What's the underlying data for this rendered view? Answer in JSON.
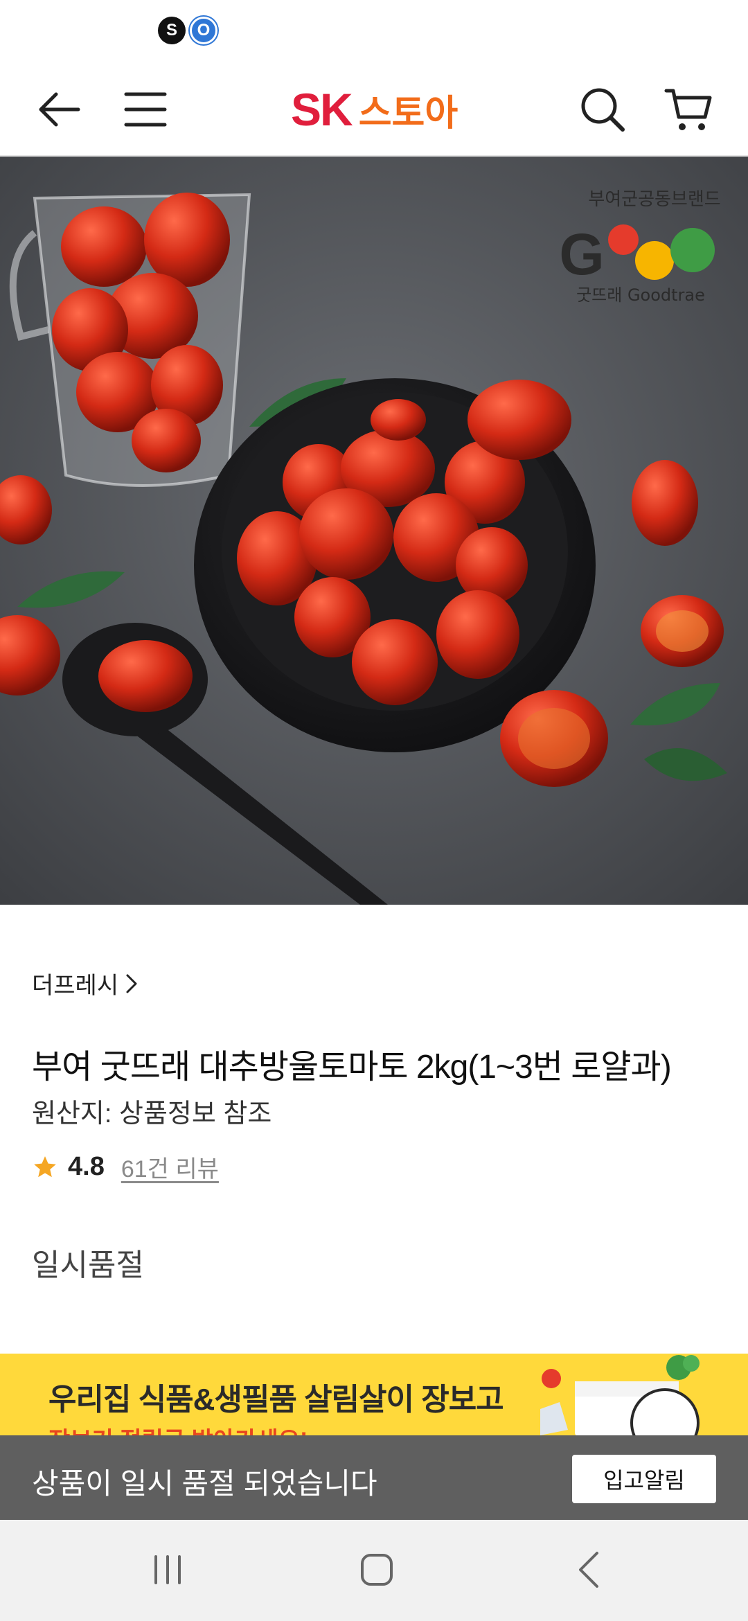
{
  "status_bar": {
    "icons": [
      "s-app-icon",
      "o-app-icon"
    ],
    "s_label": "S",
    "o_label": "O"
  },
  "header": {
    "logo_brand": "SK",
    "logo_store": "스토아",
    "icons": [
      "back-arrow-icon",
      "hamburger-menu-icon",
      "search-icon",
      "cart-icon"
    ],
    "colors": {
      "brand_red": "#e01e3c",
      "brand_orange": "#f26c1a"
    }
  },
  "product_image": {
    "brand_caption": "부여군공동브랜드",
    "brand_logo_text": "G",
    "brand_name": "굿뜨래 Goodtrae"
  },
  "product": {
    "seller": "더프레시",
    "title": "부여 굿뜨래 대추방울토마토 2kg(1~3번 로얄과)",
    "origin": "원산지: 상품정보 참조",
    "rating": "4.8",
    "reviews": "61건 리뷰",
    "status": "일시품절"
  },
  "banner": {
    "headline": "우리집 식품&생필품 살림살이 장보고",
    "subline": "장보기 적립금 받아가세요!",
    "background": "#ffd93b"
  },
  "soldout_bar": {
    "message": "상품이 일시 품절 되었습니다",
    "button_label": "입고알림"
  },
  "nav_bar": {
    "icons": [
      "recent-apps-icon",
      "home-icon",
      "back-icon"
    ]
  }
}
